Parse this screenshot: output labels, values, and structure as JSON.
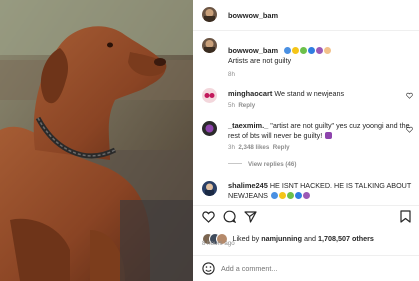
{
  "post": {
    "author": "bowwow_bam",
    "caption_author": "bowwow_bam",
    "caption_text": "Artists are not guilty",
    "caption_time": "8h"
  },
  "comments": [
    {
      "user": "minghaocart",
      "text": "We stand w newjeans",
      "time": "5h",
      "reply": "Reply"
    },
    {
      "user": "_taexmim._",
      "text": "\"artist are not guilty\" yes cuz yoongi and the rest of bts will never be guilty! ",
      "time": "3h",
      "likes": "2,348 likes",
      "reply": "Reply"
    },
    {
      "user": "shalime245",
      "text": "HE ISNT HACKED. HE IS TALKING ABOUT NEWJEANS",
      "time": ""
    }
  ],
  "view_replies": "View replies (46)",
  "likes": {
    "prefix": "Liked by ",
    "user1": "namjunning",
    "mid": " and ",
    "count": "1,708,507 others"
  },
  "post_time": "8 hours ago",
  "comment_placeholder": "Add a comment..."
}
